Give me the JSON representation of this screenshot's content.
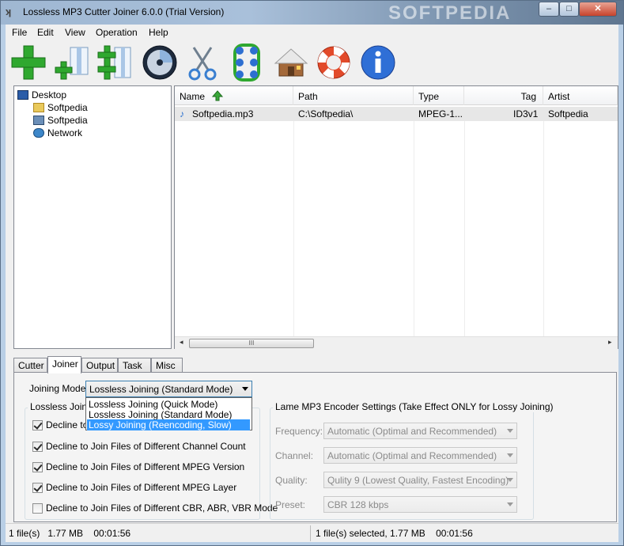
{
  "window": {
    "title": "Lossless MP3 Cutter Joiner 6.0.0 (Trial Version)",
    "watermark": "SOFTPEDIA",
    "controls": {
      "minimize": "–",
      "maximize": "□",
      "close": "✕"
    }
  },
  "menu": [
    "File",
    "Edit",
    "View",
    "Operation",
    "Help"
  ],
  "toolbar": [
    {
      "name": "add-icon"
    },
    {
      "name": "add-files-icon"
    },
    {
      "name": "add-folder-icon"
    },
    {
      "name": "cd-icon"
    },
    {
      "name": "scissors-icon"
    },
    {
      "name": "join-icon"
    },
    {
      "name": "home-icon"
    },
    {
      "name": "lifebuoy-icon"
    },
    {
      "name": "info-icon"
    }
  ],
  "tree": {
    "items": [
      "Desktop",
      "Softpedia",
      "Softpedia",
      "Network"
    ]
  },
  "file_list": {
    "columns": [
      "Name",
      "Path",
      "Type",
      "Tag",
      "Artist"
    ],
    "rows": [
      {
        "name": "Softpedia.mp3",
        "path": "C:\\Softpedia\\",
        "type": "MPEG-1...",
        "tag": "ID3v1",
        "artist": "Softpedia"
      }
    ],
    "scroll_thumb": "III",
    "scroll_left": "◂",
    "scroll_right": "▸"
  },
  "tabs": [
    "Cutter",
    "Joiner",
    "Output",
    "Task",
    "Misc"
  ],
  "active_tab": "Joiner",
  "joiner": {
    "mode_label": "Joining Mode:",
    "mode_value": "Lossless Joining (Standard Mode)",
    "mode_options": [
      "Lossless Joining (Quick Mode)",
      "Lossless Joining (Standard Mode)",
      "Lossy Joining (Reencoding, Slow)"
    ],
    "lossless_group_title": "Lossless Joining",
    "checkboxes": [
      {
        "label": "Decline to Join Files of Different Sample Rate",
        "checked": true
      },
      {
        "label": "Decline to Join Files of Different Channel Count",
        "checked": true
      },
      {
        "label": "Decline to Join Files of Different MPEG Version",
        "checked": true
      },
      {
        "label": "Decline to Join Files of Different MPEG Layer",
        "checked": true
      },
      {
        "label": "Decline to Join Files of Different CBR, ABR, VBR Mode",
        "checked": false
      }
    ],
    "lame_group_title": "Lame MP3 Encoder Settings (Take Effect ONLY for Lossy Joining)",
    "lame_settings": [
      {
        "label": "Frequency:",
        "value": "Automatic (Optimal and Recommended)"
      },
      {
        "label": "Channel:",
        "value": "Automatic (Optimal and Recommended)"
      },
      {
        "label": "Quality:",
        "value": "Qulity 9 (Lowest Quality, Fastest Encoding)"
      },
      {
        "label": "Preset:",
        "value": "CBR 128 kbps"
      }
    ]
  },
  "status": {
    "left": "1 file(s)   1.77 MB    00:01:56",
    "right": "1 file(s) selected, 1.77 MB    00:01:56"
  }
}
